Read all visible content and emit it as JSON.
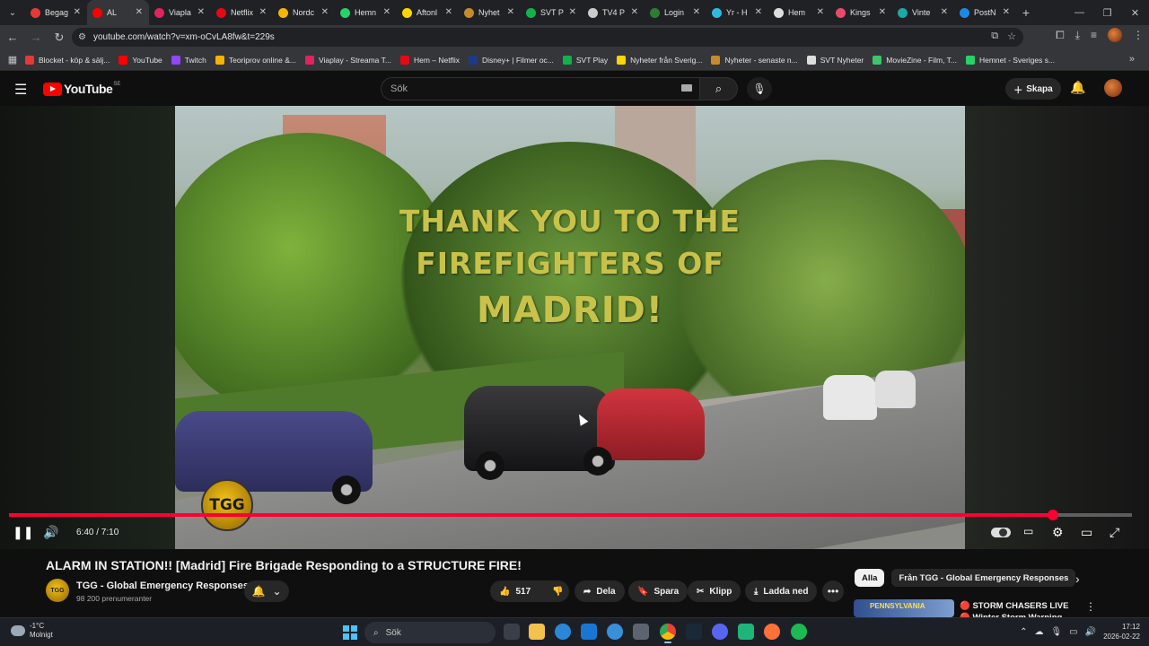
{
  "browser": {
    "tabs": [
      {
        "label": "Begag",
        "color": "#e53935",
        "active": false
      },
      {
        "label": "AL",
        "color": "#ff0000",
        "active": true
      },
      {
        "label": "Viapla",
        "color": "#e0245e",
        "active": false
      },
      {
        "label": "Netflix",
        "color": "#e50914",
        "active": false
      },
      {
        "label": "Nordc",
        "color": "#f4b400",
        "active": false
      },
      {
        "label": "Hemn",
        "color": "#25d366",
        "active": false
      },
      {
        "label": "Aftonl",
        "color": "#ffd400",
        "active": false
      },
      {
        "label": "Nyhet",
        "color": "#c58b2a",
        "active": false
      },
      {
        "label": "SVT P",
        "color": "#14b14b",
        "active": false
      },
      {
        "label": "TV4 P",
        "color": "#cccccc",
        "active": false
      },
      {
        "label": "Login",
        "color": "#2e7d32",
        "active": false
      },
      {
        "label": "Yr - H",
        "color": "#2dbbe0",
        "active": false
      },
      {
        "label": "Hem",
        "color": "#dddddd",
        "active": false
      },
      {
        "label": "Kings",
        "color": "#e84b6a",
        "active": false
      },
      {
        "label": "Vinte",
        "color": "#1fa6a6",
        "active": false
      },
      {
        "label": "PostN",
        "color": "#1e88e5",
        "active": false
      }
    ],
    "url": "youtube.com/watch?v=xm-oCvLA8fw&t=229s",
    "bookmarks": [
      {
        "label": "Blocket - köp & sälj...",
        "color": "#e53935"
      },
      {
        "label": "YouTube",
        "color": "#ff0000"
      },
      {
        "label": "Twitch",
        "color": "#9146ff"
      },
      {
        "label": "Teoriprov online &...",
        "color": "#f4b400"
      },
      {
        "label": "Viaplay - Streama T...",
        "color": "#e0245e"
      },
      {
        "label": "Hem – Netflix",
        "color": "#e50914"
      },
      {
        "label": "Disney+ | Filmer oc...",
        "color": "#1a3a8a"
      },
      {
        "label": "SVT Play",
        "color": "#14b14b"
      },
      {
        "label": "Nyheter från Sverig...",
        "color": "#ffd400"
      },
      {
        "label": "Nyheter - senaste n...",
        "color": "#c58b2a"
      },
      {
        "label": "SVT Nyheter",
        "color": "#dddddd"
      },
      {
        "label": "MovieZine - Film, T...",
        "color": "#3ec46d"
      },
      {
        "label": "Hemnet - Sveriges s...",
        "color": "#25d366"
      }
    ]
  },
  "youtube": {
    "logo_text": "YouTube",
    "region": "SE",
    "search_placeholder": "Sök",
    "create_label": "Skapa"
  },
  "player": {
    "overlay_line1": "THANK YOU TO THE",
    "overlay_line2": "FIREFIGHTERS OF",
    "overlay_line3": "MADRID!",
    "watermark": "TGG",
    "current_time": "6:40",
    "duration": "7:10",
    "time_display": "6:40 / 7:10",
    "progress_fraction": 0.93
  },
  "video_info": {
    "title": "ALARM IN STATION!! [Madrid] Fire Brigade Responding to a STRUCTURE FIRE!",
    "channel_name": "TGG - Global Emergency Responses",
    "subscribers": "98 200 prenumeranter",
    "like_count": "517",
    "share_label": "Dela",
    "save_label": "Spara",
    "clip_label": "Klipp",
    "download_label": "Ladda ned"
  },
  "sidebar": {
    "chips": [
      "Alla",
      "Från TGG - Global Emergency Responses"
    ],
    "recommendation": {
      "thumb_text": "PENNSYLVANIA",
      "title": "🔴 STORM CHASERS LIVE 🔴 Winter Storm Warning"
    }
  },
  "taskbar": {
    "temperature": "-1°C",
    "weather": "Molnigt",
    "search_placeholder": "Sök",
    "time": "17:12",
    "date": "2026-02-22"
  }
}
